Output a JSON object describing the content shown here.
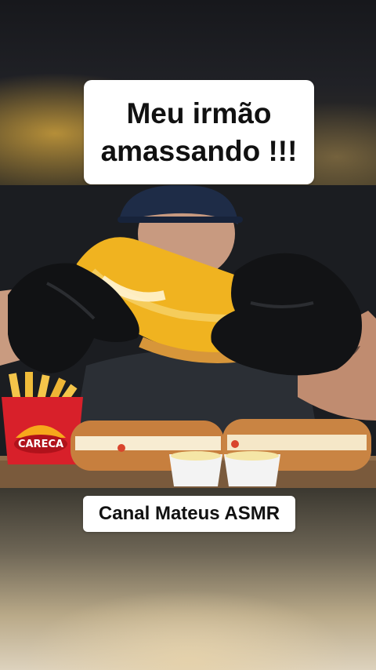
{
  "overlay": {
    "top_caption": "Meu irmão amassando !!!",
    "bottom_caption": "Canal Mateus ASMR"
  },
  "video": {
    "fries_box_logo": "CARECA",
    "icons": [
      "fries-box",
      "sandwich",
      "gloved-hand",
      "sauce-cup",
      "cap"
    ]
  },
  "colors": {
    "caption_bg": "#ffffff",
    "caption_text": "#111111",
    "box_red": "#d8202a",
    "cheese_yellow": "#f0b320"
  }
}
